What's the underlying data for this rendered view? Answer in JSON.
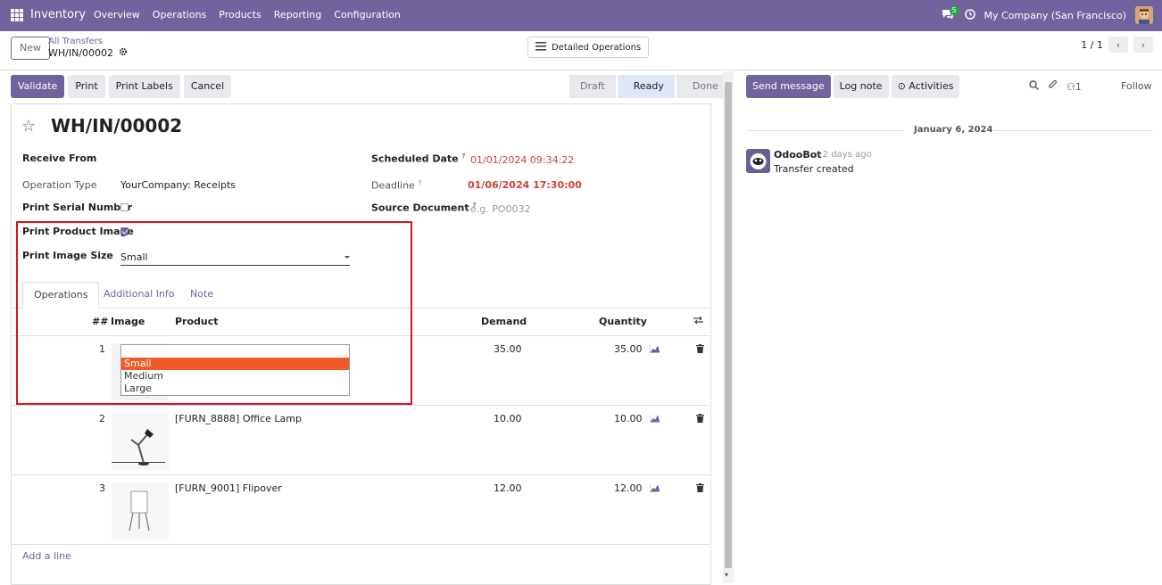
{
  "navbar": {
    "app_name": "Inventory",
    "menu": [
      "Overview",
      "Operations",
      "Products",
      "Reporting",
      "Configuration"
    ],
    "chat_badge": "5",
    "company": "My Company (San Francisco)"
  },
  "control_panel": {
    "new_label": "New",
    "breadcrumb_parent": "All Transfers",
    "breadcrumb_current": "WH/IN/00002",
    "detailed_operations_label": "Detailed Operations",
    "pager": "1 / 1"
  },
  "actions": {
    "validate": "Validate",
    "print": "Print",
    "print_labels": "Print Labels",
    "cancel": "Cancel"
  },
  "statusbar": [
    "Draft",
    "Ready",
    "Done"
  ],
  "form": {
    "title": "WH/IN/00002",
    "receive_from_label": "Receive From",
    "operation_type_label": "Operation Type",
    "operation_type_value": "YourCompany: Receipts",
    "print_serial_label": "Print Serial Number",
    "print_product_image_label": "Print Product Image",
    "print_image_size_label": "Print Image Size",
    "print_image_size_value": "Small",
    "scheduled_date_label": "Scheduled Date",
    "scheduled_date_value": "01/01/2024 09:34:22",
    "deadline_label": "Deadline",
    "deadline_value": "01/06/2024 17:30:00",
    "source_document_label": "Source Document",
    "source_document_placeholder": "e.g. PO0032",
    "qm": "?"
  },
  "dropdown_options": [
    "Small",
    "Medium",
    "Large"
  ],
  "tabs": [
    "Operations",
    "Additional Info",
    "Note"
  ],
  "table": {
    "headers": {
      "num": "##",
      "image": "Image",
      "product": "Product",
      "demand": "Demand",
      "quantity": "Quantity"
    },
    "rows": [
      {
        "num": "1",
        "product": "",
        "demand": "35.00",
        "quantity": "35.00"
      },
      {
        "num": "2",
        "product": "[FURN_8888] Office Lamp",
        "demand": "10.00",
        "quantity": "10.00"
      },
      {
        "num": "3",
        "product": "[FURN_9001] Flipover",
        "demand": "12.00",
        "quantity": "12.00"
      }
    ],
    "add_line": "Add a line"
  },
  "chatter": {
    "send_message": "Send message",
    "log_note": "Log note",
    "activities": "Activities",
    "followers_count": "1",
    "follow": "Follow",
    "date_separator": "January 6, 2024",
    "author": "OdooBot",
    "time": "- 2 days ago",
    "body": "Transfer created"
  },
  "colors": {
    "brand": "#71639e",
    "highlight": "#d8141b",
    "date_red": "#d23f3a",
    "option_selected": "#ef5a28"
  }
}
